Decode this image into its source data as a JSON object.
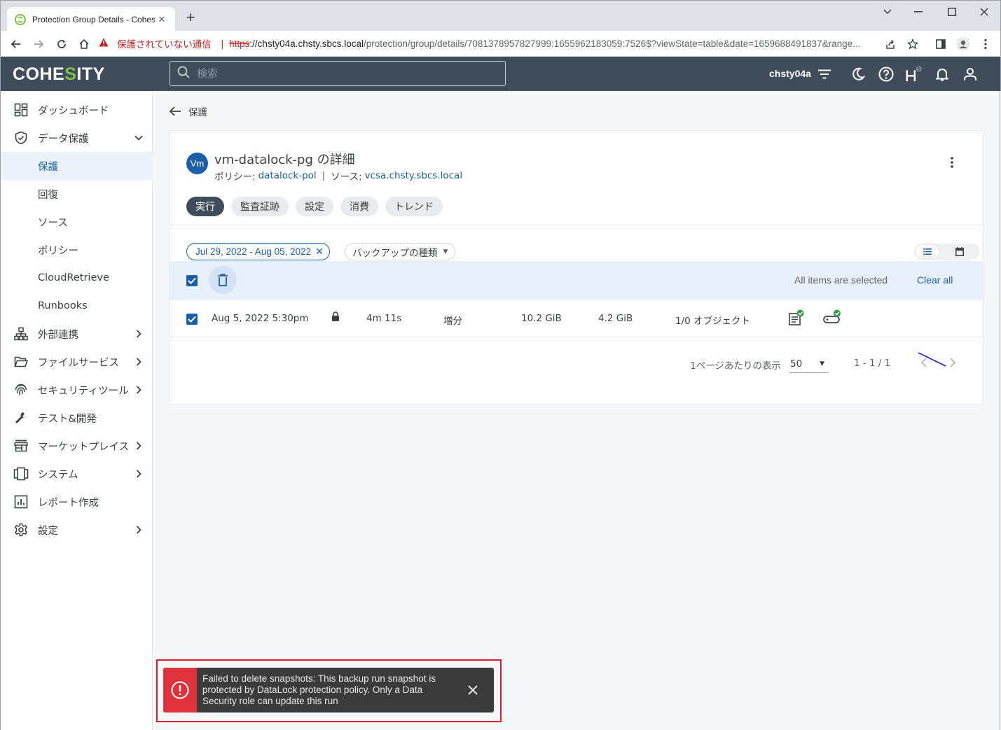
{
  "browser": {
    "tab_title": "Protection Group Details - Cohesity",
    "new_tab": "+",
    "security_warning": "保護されていない通信",
    "url_scheme": "https",
    "url_host": "://chsty04a.chsty.sbcs.local",
    "url_path": "/protection/group/details/7081378957827999:1655962183059:7526$?viewState=table&date=1659688491837&range..."
  },
  "header": {
    "logo_pre": "COHE",
    "logo_s": "S",
    "logo_post": "ITY",
    "search_placeholder": "検索",
    "cluster_name": "chsty04a"
  },
  "sidebar": {
    "items": [
      {
        "label": "ダッシュボード",
        "icon": "dashboard-icon"
      },
      {
        "label": "データ保護",
        "icon": "shield-icon",
        "expanded": true
      },
      {
        "label": "保護",
        "active": true
      },
      {
        "label": "回復"
      },
      {
        "label": "ソース"
      },
      {
        "label": "ポリシー"
      },
      {
        "label": "CloudRetrieve"
      },
      {
        "label": "Runbooks"
      },
      {
        "label": "外部連携",
        "icon": "network-icon"
      },
      {
        "label": "ファイルサービス",
        "icon": "folder-icon"
      },
      {
        "label": "セキュリティツール",
        "icon": "fingerprint-icon"
      },
      {
        "label": "テスト&開発",
        "icon": "wrench-icon"
      },
      {
        "label": "マーケットプレイス",
        "icon": "store-icon"
      },
      {
        "label": "システム",
        "icon": "system-icon"
      },
      {
        "label": "レポート作成",
        "icon": "report-icon"
      },
      {
        "label": "設定",
        "icon": "gear-icon"
      }
    ]
  },
  "main": {
    "back_label": "保護",
    "avatar_text": "Vm",
    "title": "vm-datalock-pg の詳細",
    "policy_label": "ポリシー:",
    "policy_value": "datalock-pol",
    "source_label": "ソース:",
    "source_value": "vcsa.chsty.sbcs.local",
    "tabs": [
      {
        "label": "実行",
        "selected": true
      },
      {
        "label": "監査証跡"
      },
      {
        "label": "設定"
      },
      {
        "label": "消費"
      },
      {
        "label": "トレンド"
      }
    ],
    "date_filter": "Jul 29, 2022 - Aug 05, 2022",
    "type_filter": "バックアップの種類",
    "selection_info": "All items are selected",
    "clear_all": "Clear all",
    "runs": [
      {
        "start_time": "Aug 5, 2022 5:30pm",
        "duration": "4m 11s",
        "type": "増分",
        "data_read": "10.2 GiB",
        "data_written": "4.2 GiB",
        "objects": "1/0 オブジェクト"
      }
    ],
    "per_page_label": "1ページあたりの表示",
    "per_page_value": "50",
    "range": "1 - 1 / 1"
  },
  "toast": {
    "message": "Failed to delete snapshots: This backup run snapshot is protected by DataLock protection policy. Only a Data Security role can update this run"
  },
  "colors": {
    "accent": "#1a5fa8",
    "header_bg": "#3f4c5a",
    "error": "#e0323a",
    "success": "#2e9e44"
  }
}
